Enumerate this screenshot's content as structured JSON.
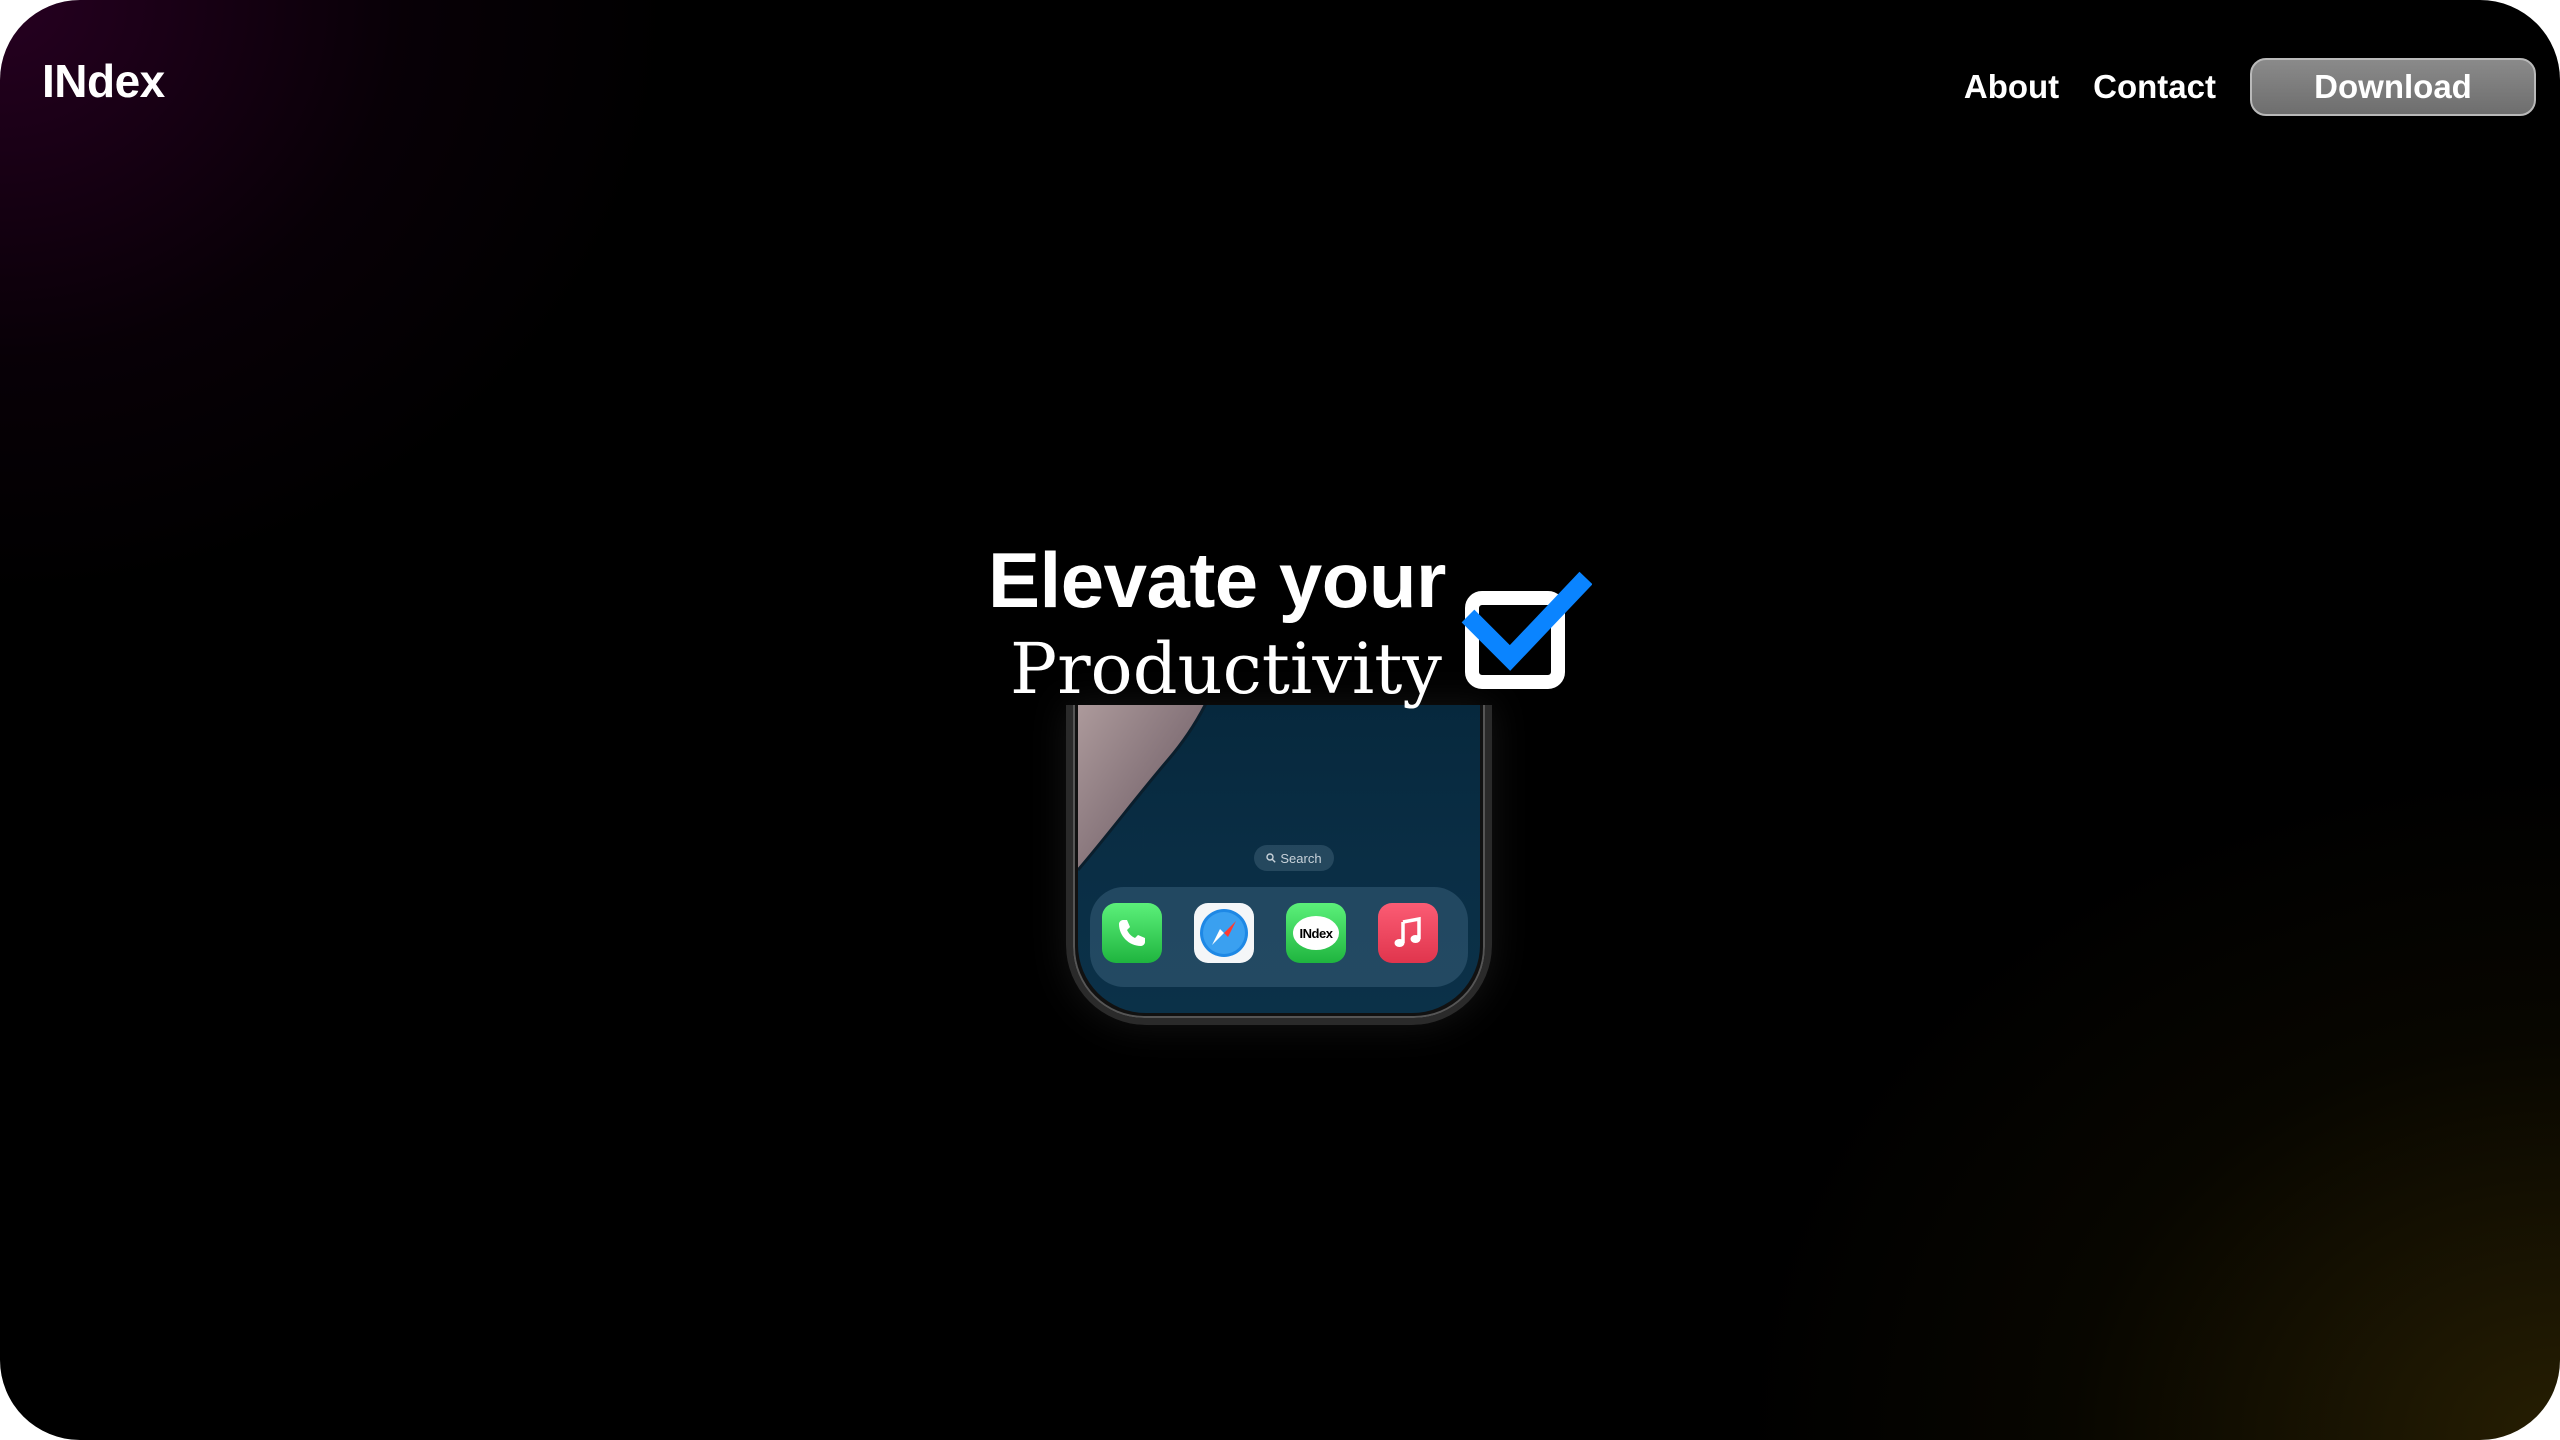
{
  "brand": {
    "logo": "INdex"
  },
  "nav": {
    "links": [
      {
        "label": "About"
      },
      {
        "label": "Contact"
      }
    ],
    "download_label": "Download"
  },
  "hero": {
    "title": "Elevate your",
    "subtitle": "Productivity",
    "icon": "checkbox-checked-icon",
    "accent_color": "#0a84ff"
  },
  "phone": {
    "search_label": "Search",
    "dock_apps": [
      {
        "name": "phone",
        "icon": "phone-icon"
      },
      {
        "name": "safari",
        "icon": "compass-icon"
      },
      {
        "name": "messages",
        "icon": "message-bubble-icon",
        "label": "INdex"
      },
      {
        "name": "music",
        "icon": "music-note-icon"
      }
    ]
  },
  "colors": {
    "background": "#000000",
    "text": "#ffffff",
    "button": "#7a7a7a"
  }
}
